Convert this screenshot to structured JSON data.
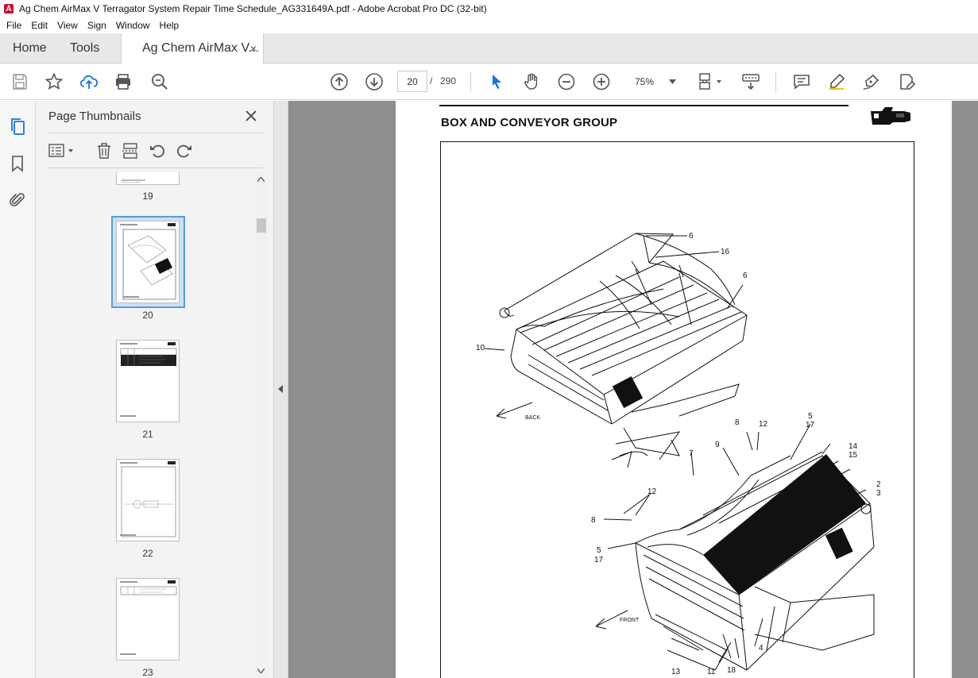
{
  "window": {
    "title": "Ag Chem AirMax V Terragator System Repair Time Schedule_AG331649A.pdf - Adobe Acrobat Pro DC (32-bit)"
  },
  "menu": [
    "File",
    "Edit",
    "View",
    "Sign",
    "Window",
    "Help"
  ],
  "tabs": {
    "home": "Home",
    "tools": "Tools",
    "document": "Ag Chem AirMax V...",
    "close": "×"
  },
  "toolbar": {
    "current_page": "20",
    "page_separator": "/",
    "total_pages": "290",
    "zoom": "75%"
  },
  "thumbnails": {
    "title": "Page Thumbnails",
    "pages": [
      "19",
      "20",
      "21",
      "22",
      "23"
    ],
    "selected": "20"
  },
  "document": {
    "heading": "BOX AND CONVEYOR GROUP",
    "callouts": {
      "c6a": "6",
      "c16": "16",
      "c6b": "6",
      "c10": "10",
      "back": "BACK",
      "c8a": "8",
      "c12a": "12",
      "c5a": "5",
      "c17a": "17",
      "c14": "14",
      "c15": "15",
      "c7": "7",
      "c9": "9",
      "c2": "2",
      "c3": "3",
      "c12b": "12",
      "c8b": "8",
      "c5b": "5",
      "c17b": "17",
      "front": "FRONT",
      "c4": "4",
      "c13": "13",
      "c11": "11",
      "c18": "18"
    }
  },
  "colors": {
    "accent": "#1473e6",
    "thumb_selected_border": "#5b9bd5",
    "doc_background": "#8e8e8e"
  }
}
